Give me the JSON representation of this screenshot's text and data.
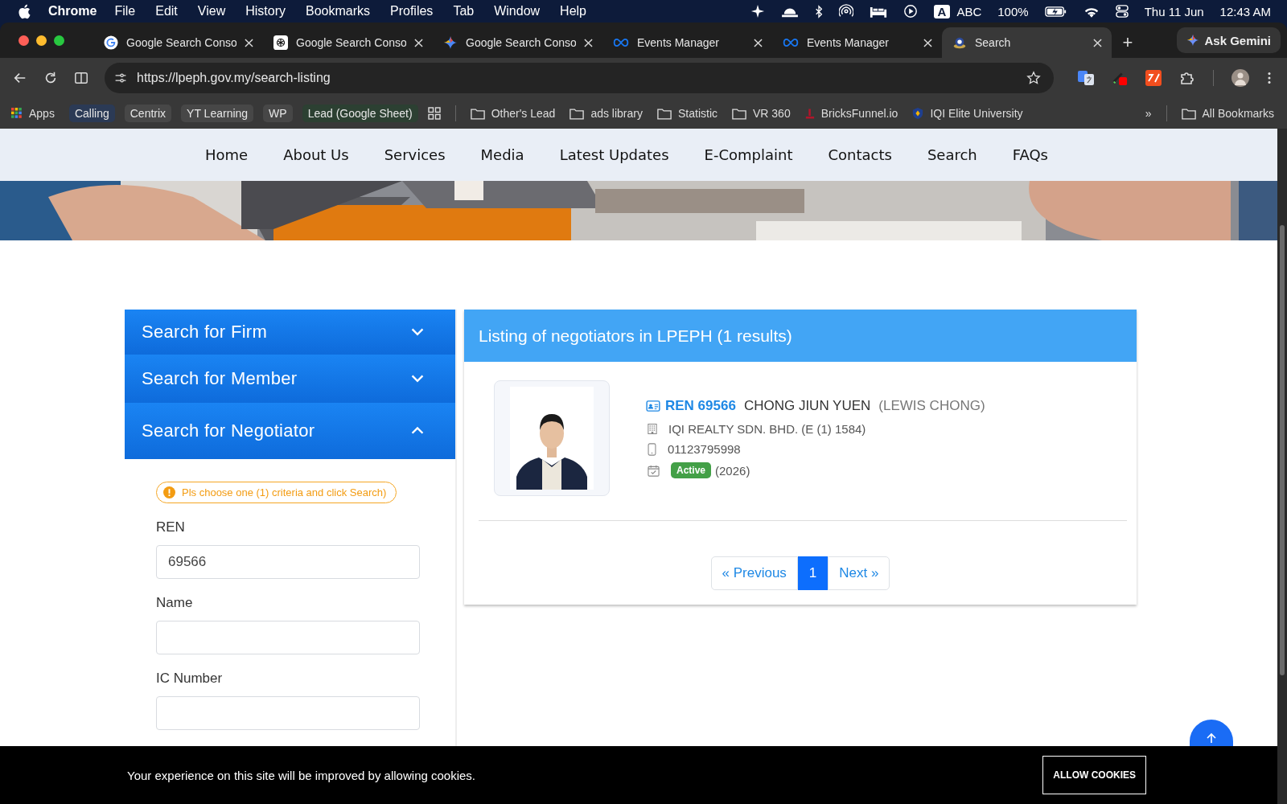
{
  "menubar": {
    "app": "Chrome",
    "items": [
      "File",
      "Edit",
      "View",
      "History",
      "Bookmarks",
      "Profiles",
      "Tab",
      "Window",
      "Help"
    ],
    "input_badge": "A",
    "input_source": "ABC",
    "battery": "100%",
    "date": "Thu 11 Jun",
    "time": "12:43 AM"
  },
  "tabs": [
    {
      "title": "Google Search Conso",
      "kind": "google",
      "selected": false
    },
    {
      "title": "Google Search Conso",
      "kind": "chatgpt",
      "selected": false
    },
    {
      "title": "Google Search Conso",
      "kind": "gemini",
      "selected": false
    },
    {
      "title": "Events Manager",
      "kind": "meta",
      "selected": false
    },
    {
      "title": "Events Manager",
      "kind": "meta",
      "selected": false
    },
    {
      "title": "Search",
      "kind": "site",
      "selected": true
    }
  ],
  "new_tab": "+",
  "ask_gemini": "Ask Gemini",
  "address": {
    "url": "https://lpeph.gov.my/search-listing"
  },
  "bookmarks": [
    {
      "label": "Apps",
      "kind": "apps"
    },
    {
      "label": "Calling",
      "kind": "chip",
      "color": "#2b3a55"
    },
    {
      "label": "Centrix",
      "kind": "chip",
      "color": "#474747"
    },
    {
      "label": "YT Learning",
      "kind": "chip",
      "color": "#474747"
    },
    {
      "label": "WP",
      "kind": "chip",
      "color": "#474747"
    },
    {
      "label": "Lead (Google Sheet)",
      "kind": "chip",
      "color": "#2c4032"
    },
    {
      "kind": "grid"
    },
    {
      "label": "Other's Lead",
      "kind": "folder"
    },
    {
      "label": "ads library",
      "kind": "folder"
    },
    {
      "label": "Statistic",
      "kind": "folder"
    },
    {
      "label": "VR 360",
      "kind": "folder"
    },
    {
      "label": "BricksFunnel.io",
      "kind": "bricks"
    },
    {
      "label": "IQI Elite University",
      "kind": "shield"
    }
  ],
  "bookmarks_overflow": "»",
  "all_bookmarks": "All Bookmarks",
  "nav": [
    "Home",
    "About Us",
    "Services",
    "Media",
    "Latest Updates",
    "E-Complaint",
    "Contacts",
    "Search",
    "FAQs"
  ],
  "accordion": [
    {
      "title": "Search for Firm",
      "expanded": false
    },
    {
      "title": "Search for Member",
      "expanded": false
    },
    {
      "title": "Search for Negotiator",
      "expanded": true
    }
  ],
  "notice": "Pls choose one (1) criteria and click Search)",
  "fields": [
    {
      "label": "REN",
      "value": "69566"
    },
    {
      "label": "Name"
    },
    {
      "label": "IC Number"
    }
  ],
  "listing": {
    "title": "Listing of negotiators in LPEPH (1 results)",
    "result": {
      "ren": "REN 69566",
      "name": "CHONG JIUN YUEN",
      "alias": "(LEWIS CHONG)",
      "firm": "IQI REALTY SDN. BHD. (E (1) 1584)",
      "phone": "01123795998",
      "status": "Active",
      "year": "(2026)"
    },
    "pagination": {
      "previous": "« Previous",
      "pages": [
        {
          "label": "1",
          "selected": true
        }
      ],
      "next": "Next »"
    }
  },
  "cookie": {
    "text": "Your experience on this site will be improved by allowing cookies.",
    "button": "ALLOW COOKIES"
  }
}
